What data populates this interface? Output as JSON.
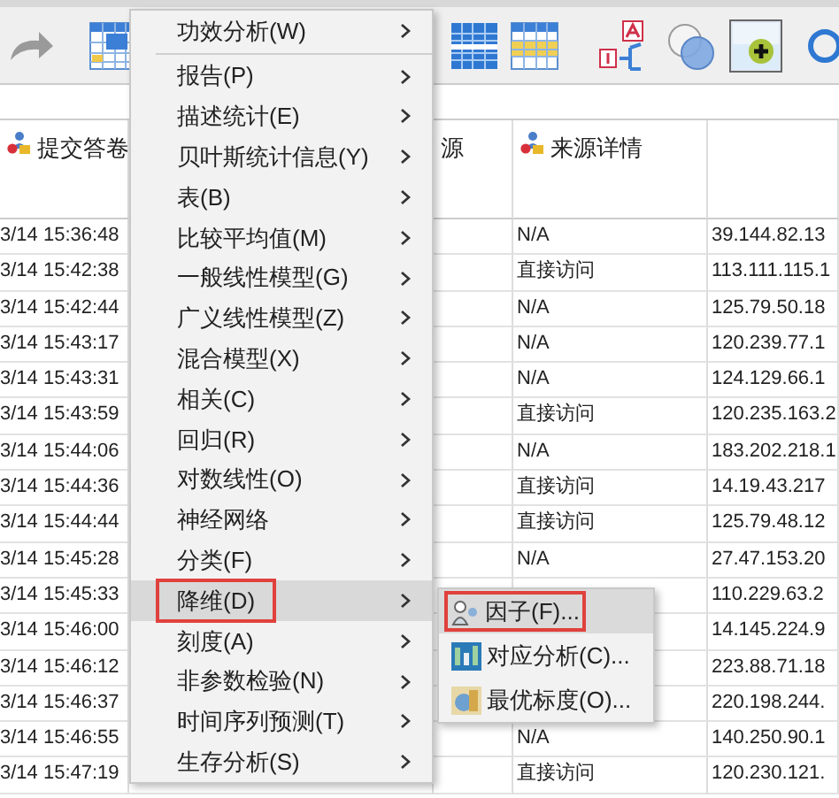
{
  "toolbar": {
    "buttons": [
      {
        "kind": "redo"
      },
      {
        "kind": "data-table"
      },
      {
        "kind": "split-grid"
      },
      {
        "kind": "yellow-grid"
      },
      {
        "kind": "value-labels"
      },
      {
        "kind": "sets"
      },
      {
        "kind": "add-case",
        "selected": true
      },
      {
        "kind": "circle"
      }
    ]
  },
  "table": {
    "columns": [
      {
        "label": "提交答卷",
        "icon": true
      },
      {},
      {
        "label": "源"
      },
      {
        "label": "来源详情",
        "icon": true
      },
      {}
    ],
    "rows": [
      {
        "time": "3/14 15:36:48",
        "source": "N/A",
        "ip": "39.144.82.13"
      },
      {
        "time": "3/14 15:42:38",
        "source": "直接访问",
        "ip": "113.111.115.1"
      },
      {
        "time": "3/14 15:42:44",
        "source": "N/A",
        "ip": "125.79.50.18"
      },
      {
        "time": "3/14 15:43:17",
        "source": "N/A",
        "ip": "120.239.77.1"
      },
      {
        "time": "3/14 15:43:31",
        "source": "N/A",
        "ip": "124.129.66.1"
      },
      {
        "time": "3/14 15:43:59",
        "source": "直接访问",
        "ip": "120.235.163.2"
      },
      {
        "time": "3/14 15:44:06",
        "source": "N/A",
        "ip": "183.202.218.1"
      },
      {
        "time": "3/14 15:44:36",
        "source": "直接访问",
        "ip": "14.19.43.217"
      },
      {
        "time": "3/14 15:44:44",
        "source": "直接访问",
        "ip": "125.79.48.12"
      },
      {
        "time": "3/14 15:45:28",
        "source": "N/A",
        "ip": "27.47.153.20"
      },
      {
        "time": "3/14 15:45:33",
        "ip": "110.229.63.2"
      },
      {
        "time": "3/14 15:46:00",
        "ip": "14.145.224.9"
      },
      {
        "time": "3/14 15:46:12",
        "ip": "223.88.71.18"
      },
      {
        "time": "3/14 15:46:37",
        "ip": "220.198.244."
      },
      {
        "time": "3/14 15:46:55",
        "source": "N/A",
        "ip": "140.250.90.1"
      },
      {
        "time": "3/14 15:47:19",
        "source": "直接访问",
        "ip": "120.230.121."
      }
    ]
  },
  "menu": {
    "items": [
      {
        "label": "功效分析(W)",
        "selected": false,
        "marked": false,
        "separator_after": true
      },
      {
        "label": "报告(P)",
        "selected": false,
        "marked": false
      },
      {
        "label": "描述统计(E)",
        "selected": false,
        "marked": false
      },
      {
        "label": "贝叶斯统计信息(Y)",
        "selected": false,
        "marked": false
      },
      {
        "label": "表(B)",
        "selected": false,
        "marked": false
      },
      {
        "label": "比较平均值(M)",
        "selected": false,
        "marked": false
      },
      {
        "label": "一般线性模型(G)",
        "selected": false,
        "marked": false
      },
      {
        "label": "广义线性模型(Z)",
        "selected": false,
        "marked": false
      },
      {
        "label": "混合模型(X)",
        "selected": false,
        "marked": false
      },
      {
        "label": "相关(C)",
        "selected": false,
        "marked": false
      },
      {
        "label": "回归(R)",
        "selected": false,
        "marked": false
      },
      {
        "label": "对数线性(O)",
        "selected": false,
        "marked": false
      },
      {
        "label": "神经网络",
        "selected": false,
        "marked": false
      },
      {
        "label": "分类(F)",
        "selected": false,
        "marked": false
      },
      {
        "label": "降维(D)",
        "selected": true,
        "marked": true
      },
      {
        "label": "刻度(A)",
        "selected": false,
        "marked": false
      },
      {
        "label": "非参数检验(N)",
        "selected": false,
        "marked": false
      },
      {
        "label": "时间序列预测(T)",
        "selected": false,
        "marked": false
      },
      {
        "label": "生存分析(S)",
        "selected": false,
        "marked": false
      }
    ]
  },
  "submenu": {
    "items": [
      {
        "label": "因子(F)...",
        "kind": "factor",
        "selected": true,
        "marked": true
      },
      {
        "label": "对应分析(C)...",
        "kind": "correspondence",
        "selected": false,
        "marked": false
      },
      {
        "label": "最优标度(O)...",
        "kind": "optimal",
        "selected": false,
        "marked": false
      }
    ]
  }
}
